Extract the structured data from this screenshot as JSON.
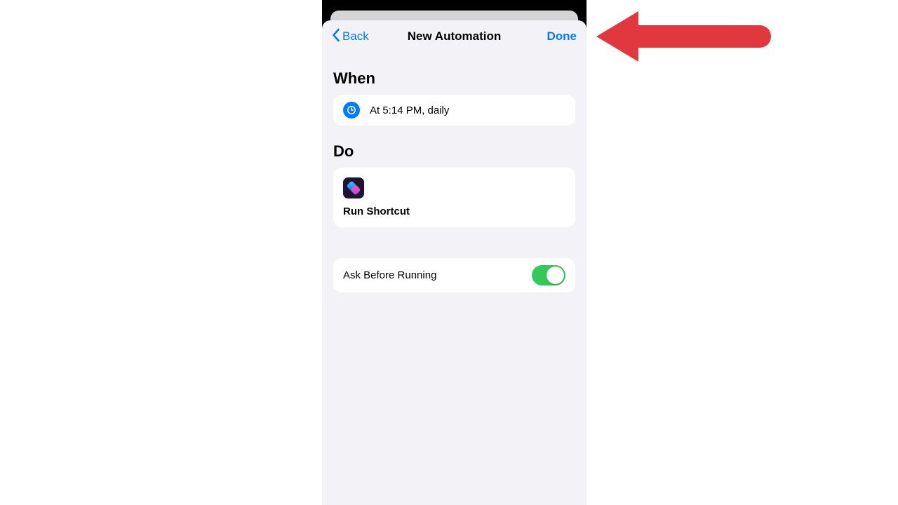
{
  "nav": {
    "back_label": "Back",
    "title": "New Automation",
    "done_label": "Done"
  },
  "when": {
    "heading": "When",
    "text": "At 5:14 PM, daily"
  },
  "do": {
    "heading": "Do",
    "action_label": "Run Shortcut"
  },
  "toggle": {
    "label": "Ask Before Running",
    "on": true
  },
  "colors": {
    "ios_blue": "#007aff",
    "ios_green": "#34c759",
    "annotation_red": "#e0383e"
  }
}
